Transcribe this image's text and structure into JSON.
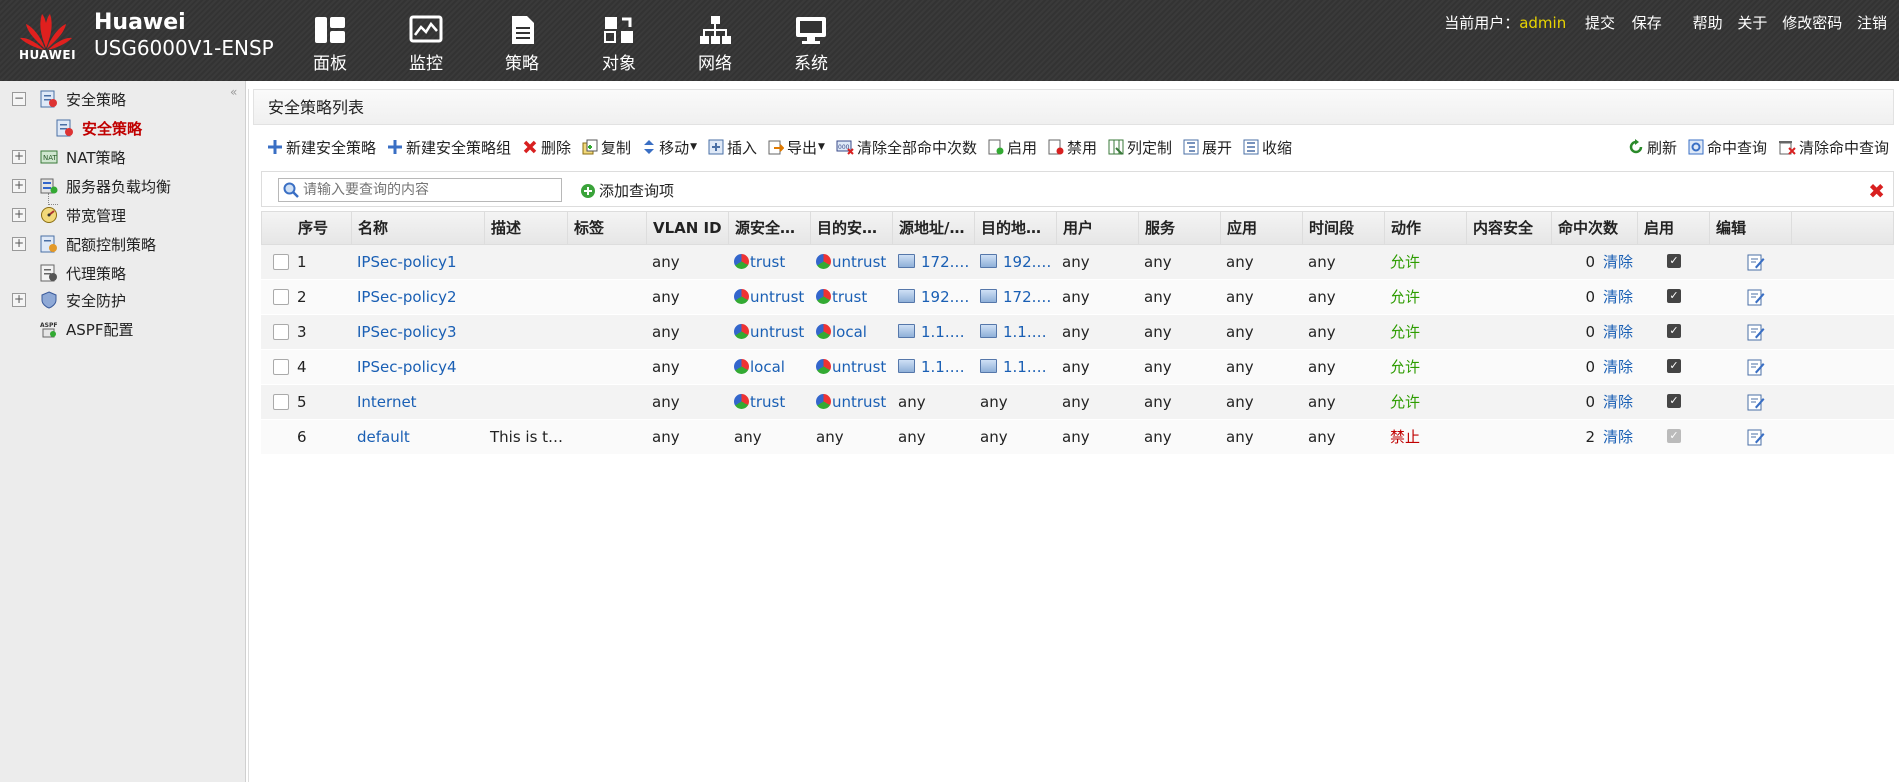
{
  "header": {
    "logo_text": "HUAWEI",
    "brand_name": "Huawei",
    "model": "USG6000V1-ENSP",
    "nav": [
      {
        "label": "面板",
        "icon": "dashboard-icon"
      },
      {
        "label": "监控",
        "icon": "monitor-icon"
      },
      {
        "label": "策略",
        "icon": "policy-icon"
      },
      {
        "label": "对象",
        "icon": "object-icon"
      },
      {
        "label": "网络",
        "icon": "network-icon"
      },
      {
        "label": "系统",
        "icon": "system-icon"
      }
    ],
    "current_user_label": "当前用户：",
    "user": "admin",
    "links": [
      "提交",
      "保存",
      "帮助",
      "关于",
      "修改密码",
      "注销"
    ]
  },
  "sidebar": {
    "items": [
      {
        "label": "安全策略",
        "expander": "−"
      },
      {
        "label": "安全策略",
        "expander": ""
      },
      {
        "label": "NAT策略",
        "expander": "+"
      },
      {
        "label": "服务器负载均衡",
        "expander": "+"
      },
      {
        "label": "带宽管理",
        "expander": "+"
      },
      {
        "label": "配额控制策略",
        "expander": "+"
      },
      {
        "label": "代理策略",
        "expander": ""
      },
      {
        "label": "安全防护",
        "expander": "+"
      },
      {
        "label": "ASPF配置",
        "expander": ""
      }
    ]
  },
  "main": {
    "title": "安全策略列表",
    "toolbar": [
      "新建安全策略",
      "新建安全策略组",
      "删除",
      "复制",
      "移动",
      "插入",
      "导出",
      "清除全部命中次数",
      "启用",
      "禁用",
      "列定制",
      "展开",
      "收缩"
    ],
    "toolbar_right": [
      "刷新",
      "命中查询",
      "清除命中查询"
    ],
    "search_placeholder": "请输入要查询的内容",
    "add_query_label": "添加查询项",
    "columns": [
      "序号",
      "名称",
      "描述",
      "标签",
      "VLAN ID",
      "源安全…",
      "目的安…",
      "源地址/…",
      "目的地…",
      "用户",
      "服务",
      "应用",
      "时间段",
      "动作",
      "内容安全",
      "命中次数",
      "启用",
      "编辑"
    ],
    "rows": [
      {
        "no": "1",
        "name": "IPSec-policy1",
        "desc": "",
        "tag": "",
        "vlan": "any",
        "src_zone": "trust",
        "dst_zone": "untrust",
        "src_addr": "172.…",
        "dst_addr": "192.…",
        "user": "any",
        "service": "any",
        "app": "any",
        "time": "any",
        "action": "允许",
        "content": "",
        "hits": "0",
        "clear": "清除",
        "selectable": true,
        "enabled": true
      },
      {
        "no": "2",
        "name": "IPSec-policy2",
        "desc": "",
        "tag": "",
        "vlan": "any",
        "src_zone": "untrust",
        "dst_zone": "trust",
        "src_addr": "192.…",
        "dst_addr": "172.…",
        "user": "any",
        "service": "any",
        "app": "any",
        "time": "any",
        "action": "允许",
        "content": "",
        "hits": "0",
        "clear": "清除",
        "selectable": true,
        "enabled": true
      },
      {
        "no": "3",
        "name": "IPSec-policy3",
        "desc": "",
        "tag": "",
        "vlan": "any",
        "src_zone": "untrust",
        "dst_zone": "local",
        "src_addr": "1.1.…",
        "dst_addr": "1.1.…",
        "user": "any",
        "service": "any",
        "app": "any",
        "time": "any",
        "action": "允许",
        "content": "",
        "hits": "0",
        "clear": "清除",
        "selectable": true,
        "enabled": true
      },
      {
        "no": "4",
        "name": "IPSec-policy4",
        "desc": "",
        "tag": "",
        "vlan": "any",
        "src_zone": "local",
        "dst_zone": "untrust",
        "src_addr": "1.1.…",
        "dst_addr": "1.1.…",
        "user": "any",
        "service": "any",
        "app": "any",
        "time": "any",
        "action": "允许",
        "content": "",
        "hits": "0",
        "clear": "清除",
        "selectable": true,
        "enabled": true
      },
      {
        "no": "5",
        "name": "Internet",
        "desc": "",
        "tag": "",
        "vlan": "any",
        "src_zone": "trust",
        "dst_zone": "untrust",
        "src_addr": "any",
        "dst_addr": "any",
        "user": "any",
        "service": "any",
        "app": "any",
        "time": "any",
        "action": "允许",
        "content": "",
        "hits": "0",
        "clear": "清除",
        "selectable": true,
        "enabled": true
      },
      {
        "no": "6",
        "name": "default",
        "desc": "This is t…",
        "tag": "",
        "vlan": "any",
        "src_zone": "any",
        "dst_zone": "any",
        "src_addr": "any",
        "dst_addr": "any",
        "user": "any",
        "service": "any",
        "app": "any",
        "time": "any",
        "action": "禁止",
        "content": "",
        "hits": "2",
        "clear": "清除",
        "selectable": false,
        "enabled": true
      }
    ]
  },
  "colors": {
    "allow": "#2d9c00",
    "deny": "#c00000",
    "link": "#1a5fb4",
    "active_nav": "#c00000"
  }
}
